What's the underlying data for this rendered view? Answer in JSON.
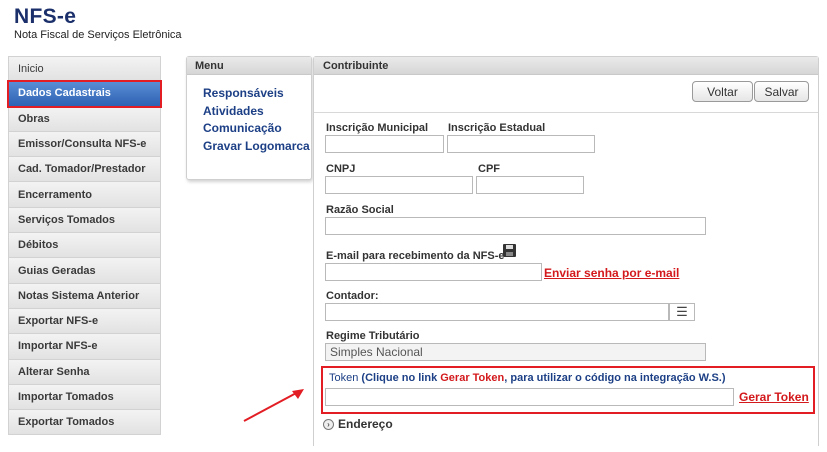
{
  "brand": {
    "title": "NFS-e",
    "subtitle": "Nota Fiscal de Serviços Eletrônica"
  },
  "sidebar": {
    "items": [
      {
        "label": "Inicio"
      },
      {
        "label": "Dados Cadastrais",
        "active": true
      },
      {
        "label": "Obras"
      },
      {
        "label": "Emissor/Consulta NFS-e"
      },
      {
        "label": "Cad. Tomador/Prestador"
      },
      {
        "label": "Encerramento"
      },
      {
        "label": "Serviços Tomados"
      },
      {
        "label": "Débitos"
      },
      {
        "label": "Guias Geradas"
      },
      {
        "label": "Notas Sistema Anterior"
      },
      {
        "label": "Exportar NFS-e"
      },
      {
        "label": "Importar NFS-e"
      },
      {
        "label": "Alterar Senha"
      },
      {
        "label": "Importar Tomados"
      },
      {
        "label": "Exportar Tomados"
      }
    ]
  },
  "menu": {
    "title": "Menu",
    "items": [
      "Responsáveis",
      "Atividades",
      "Comunicação",
      "Gravar Logomarca"
    ]
  },
  "contribuinte": {
    "title": "Contribuinte",
    "buttons": {
      "voltar": "Voltar",
      "salvar": "Salvar"
    },
    "fields": {
      "inscricao_municipal": {
        "label": "Inscrição Municipal",
        "value": ""
      },
      "inscricao_estadual": {
        "label": "Inscrição Estadual",
        "value": ""
      },
      "cnpj": {
        "label": "CNPJ",
        "value": ""
      },
      "cpf": {
        "label": "CPF",
        "value": ""
      },
      "razao_social": {
        "label": "Razão Social",
        "value": ""
      },
      "email": {
        "label": "E-mail para recebimento da NFS-e",
        "value": ""
      },
      "contador": {
        "label": "Contador:",
        "value": ""
      },
      "regime": {
        "label": "Regime Tributário",
        "value": "Simples Nacional"
      },
      "token": {
        "label_prefix": "Token",
        "label_part1": " (Clique no link ",
        "label_link": "Gerar Token",
        "label_part2": ", para utilizar o código na integração W.S.)",
        "value": ""
      }
    },
    "links": {
      "enviar_senha": "Enviar senha por e-mail",
      "gerar_token": "Gerar Token"
    },
    "endereco": "Endereço"
  },
  "colors": {
    "accent_red": "#e21d24",
    "link_blue": "#1c3f85",
    "active_blue": "#2e62b3"
  },
  "icons": [
    "save-icon",
    "list-icon",
    "chevron-circle-icon",
    "arrow-annotation"
  ]
}
